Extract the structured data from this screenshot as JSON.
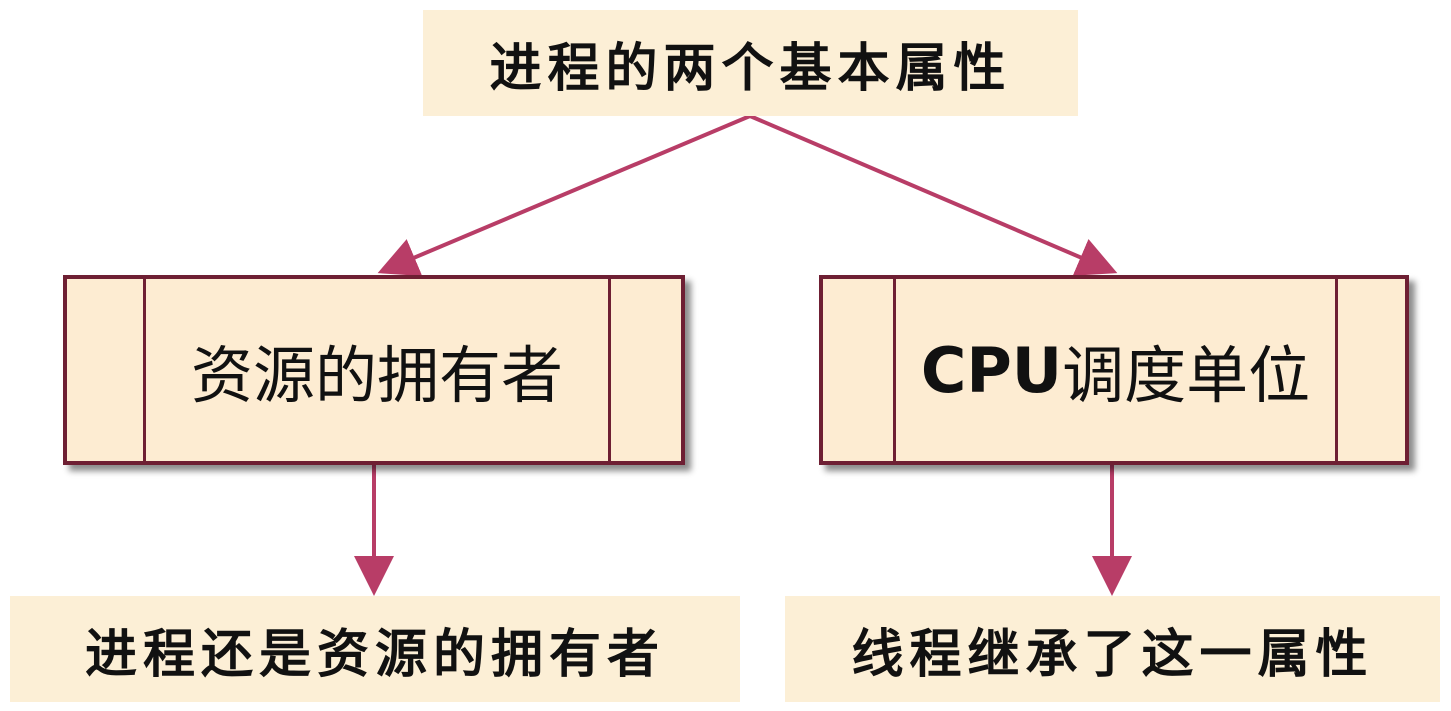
{
  "diagram": {
    "root": {
      "label": "进程的两个基本属性"
    },
    "attributes": [
      {
        "label": "资源的拥有者"
      },
      {
        "label_latin": "CPU",
        "label_cjk": "调度单位"
      }
    ],
    "conclusions": [
      {
        "label": "进程还是资源的拥有者"
      },
      {
        "label": "线程继承了这一属性"
      }
    ],
    "colors": {
      "arrow": "#b83d67",
      "box_border": "#6e1f33",
      "box_fill": "#fdecd2",
      "label_fill": "#fcefd6"
    }
  }
}
